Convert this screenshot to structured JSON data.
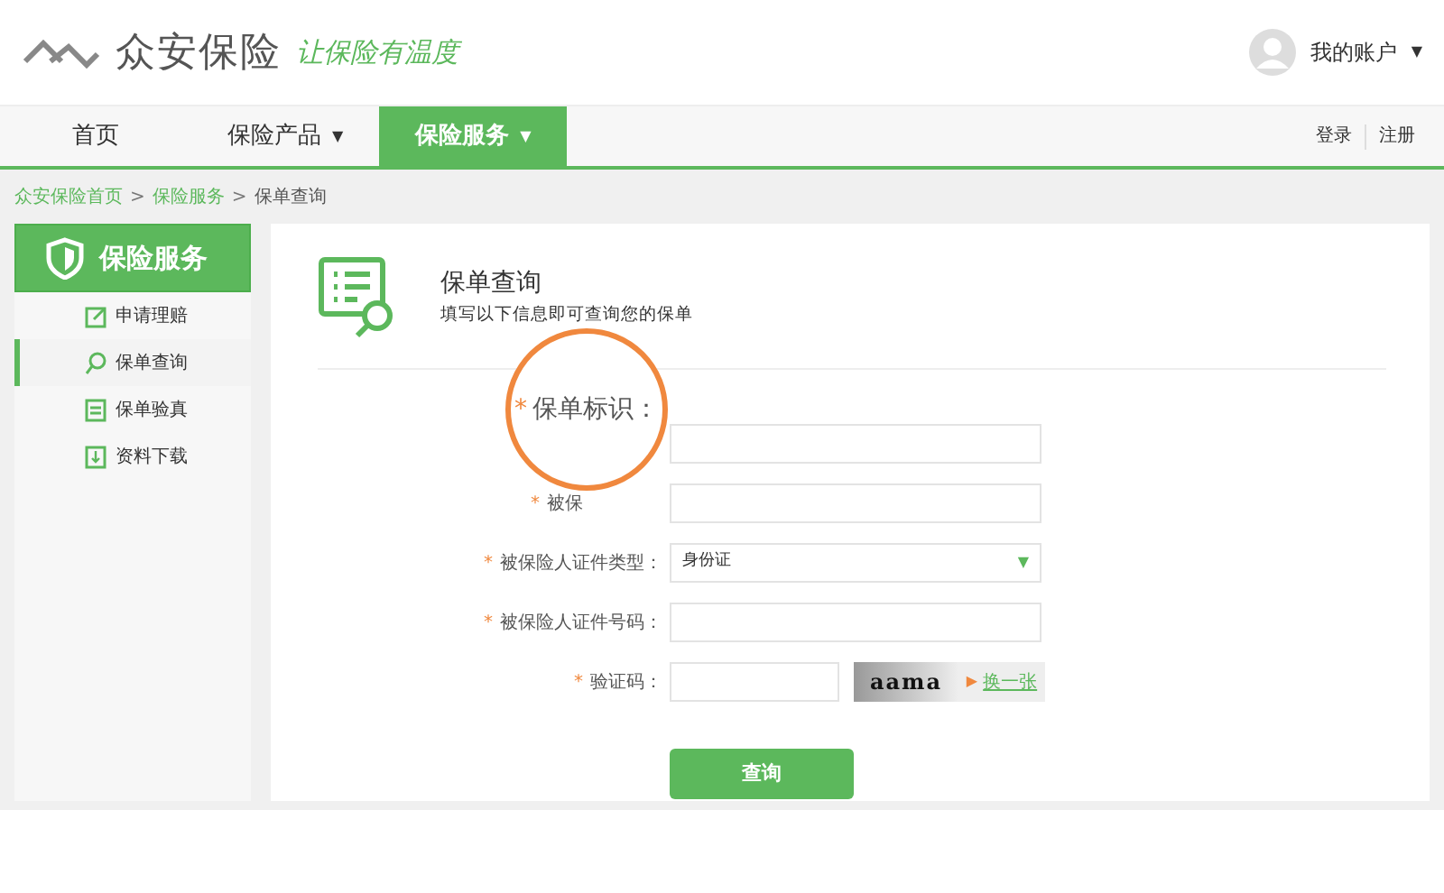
{
  "header": {
    "logo": "众安保险",
    "slogan": "让保险有温度",
    "account": "我的账户",
    "account_caret": "▼"
  },
  "nav": {
    "items": [
      {
        "label": "首页",
        "selected": false
      },
      {
        "label": "保险产品",
        "selected": false,
        "caret": "▼"
      },
      {
        "label": "保险服务",
        "selected": true,
        "caret": "▼"
      }
    ],
    "links": [
      "登录",
      "注册"
    ]
  },
  "breadcrumb": [
    {
      "label": "众安保险首页",
      "kind": "link"
    },
    {
      "label": ">",
      "kind": "separator"
    },
    {
      "label": "保险服务",
      "kind": "link"
    },
    {
      "label": ">",
      "kind": "separator"
    },
    {
      "label": "保单查询",
      "kind": "current"
    }
  ],
  "sidebar": {
    "title": "保险服务",
    "items": [
      {
        "label": "申请理赔",
        "selected": false
      },
      {
        "label": "保单查询",
        "selected": true
      },
      {
        "label": "保单验真",
        "selected": false
      },
      {
        "label": "资料下载",
        "selected": false
      }
    ]
  },
  "main": {
    "title": "保单查询",
    "subtitle": "填写以下信息即可查询您的保单",
    "fields": [
      {
        "kind": "text"
      },
      {
        "label": "被保",
        "kind": "text",
        "required": "*"
      },
      {
        "label": "被保险人证件类型：",
        "kind": "select",
        "value": "身份证",
        "caret": "▼",
        "required": "*"
      },
      {
        "label": "被保险人证件号码：",
        "kind": "text",
        "required": "*"
      },
      {
        "label": "验证码：",
        "kind": "captcha",
        "required": "*",
        "captcha": "aama",
        "refresh_mark": "▶",
        "refresh": "换一张"
      }
    ],
    "submit": "查询"
  },
  "magnifier": {
    "required": "*",
    "label": "保单标识："
  }
}
